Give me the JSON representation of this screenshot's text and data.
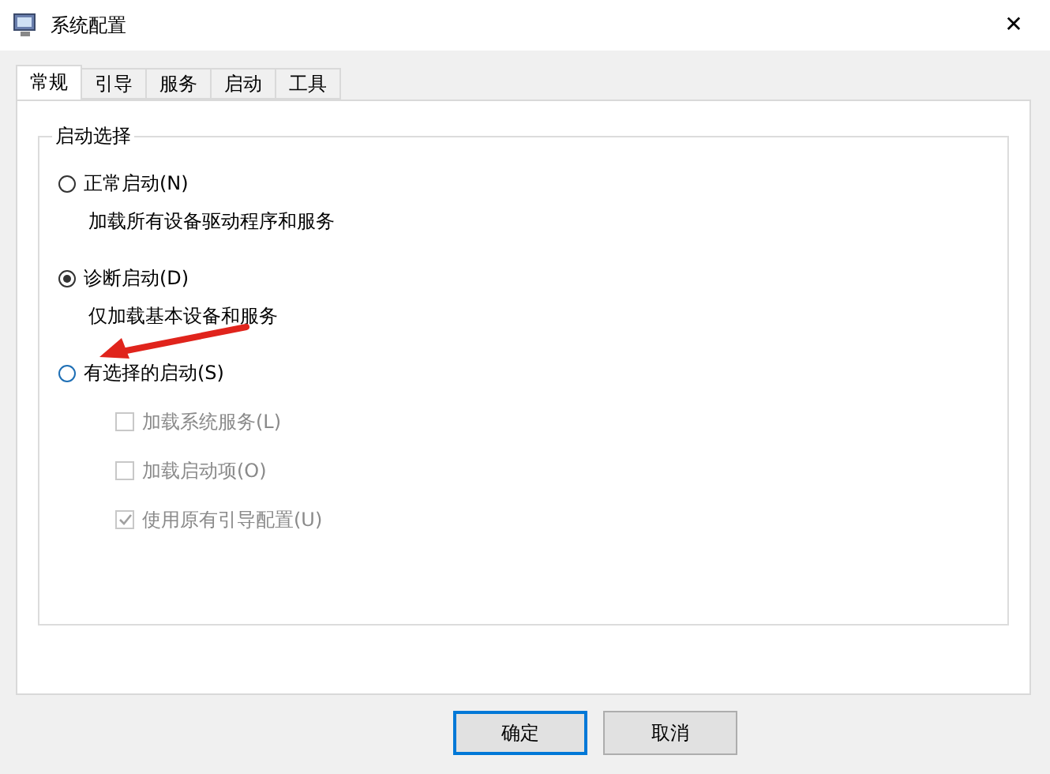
{
  "window": {
    "title": "系统配置",
    "close": "✕"
  },
  "tabs": [
    {
      "label": "常规",
      "selected": true
    },
    {
      "label": "引导",
      "selected": false
    },
    {
      "label": "服务",
      "selected": false
    },
    {
      "label": "启动",
      "selected": false
    },
    {
      "label": "工具",
      "selected": false
    }
  ],
  "group": {
    "title": "启动选择",
    "options": [
      {
        "label": "正常启动(N)",
        "selected": false,
        "description": "加载所有设备驱动程序和服务"
      },
      {
        "label": "诊断启动(D)",
        "selected": true,
        "description": "仅加载基本设备和服务"
      },
      {
        "label": "有选择的启动(S)",
        "selected": false,
        "children": [
          {
            "label": "加载系统服务(L)",
            "checked": false,
            "disabled": true
          },
          {
            "label": "加载启动项(O)",
            "checked": false,
            "disabled": true
          },
          {
            "label": "使用原有引导配置(U)",
            "checked": true,
            "disabled": true
          }
        ]
      }
    ]
  },
  "buttons": [
    {
      "label": "确定",
      "default": true
    },
    {
      "label": "取消",
      "default": false
    }
  ]
}
